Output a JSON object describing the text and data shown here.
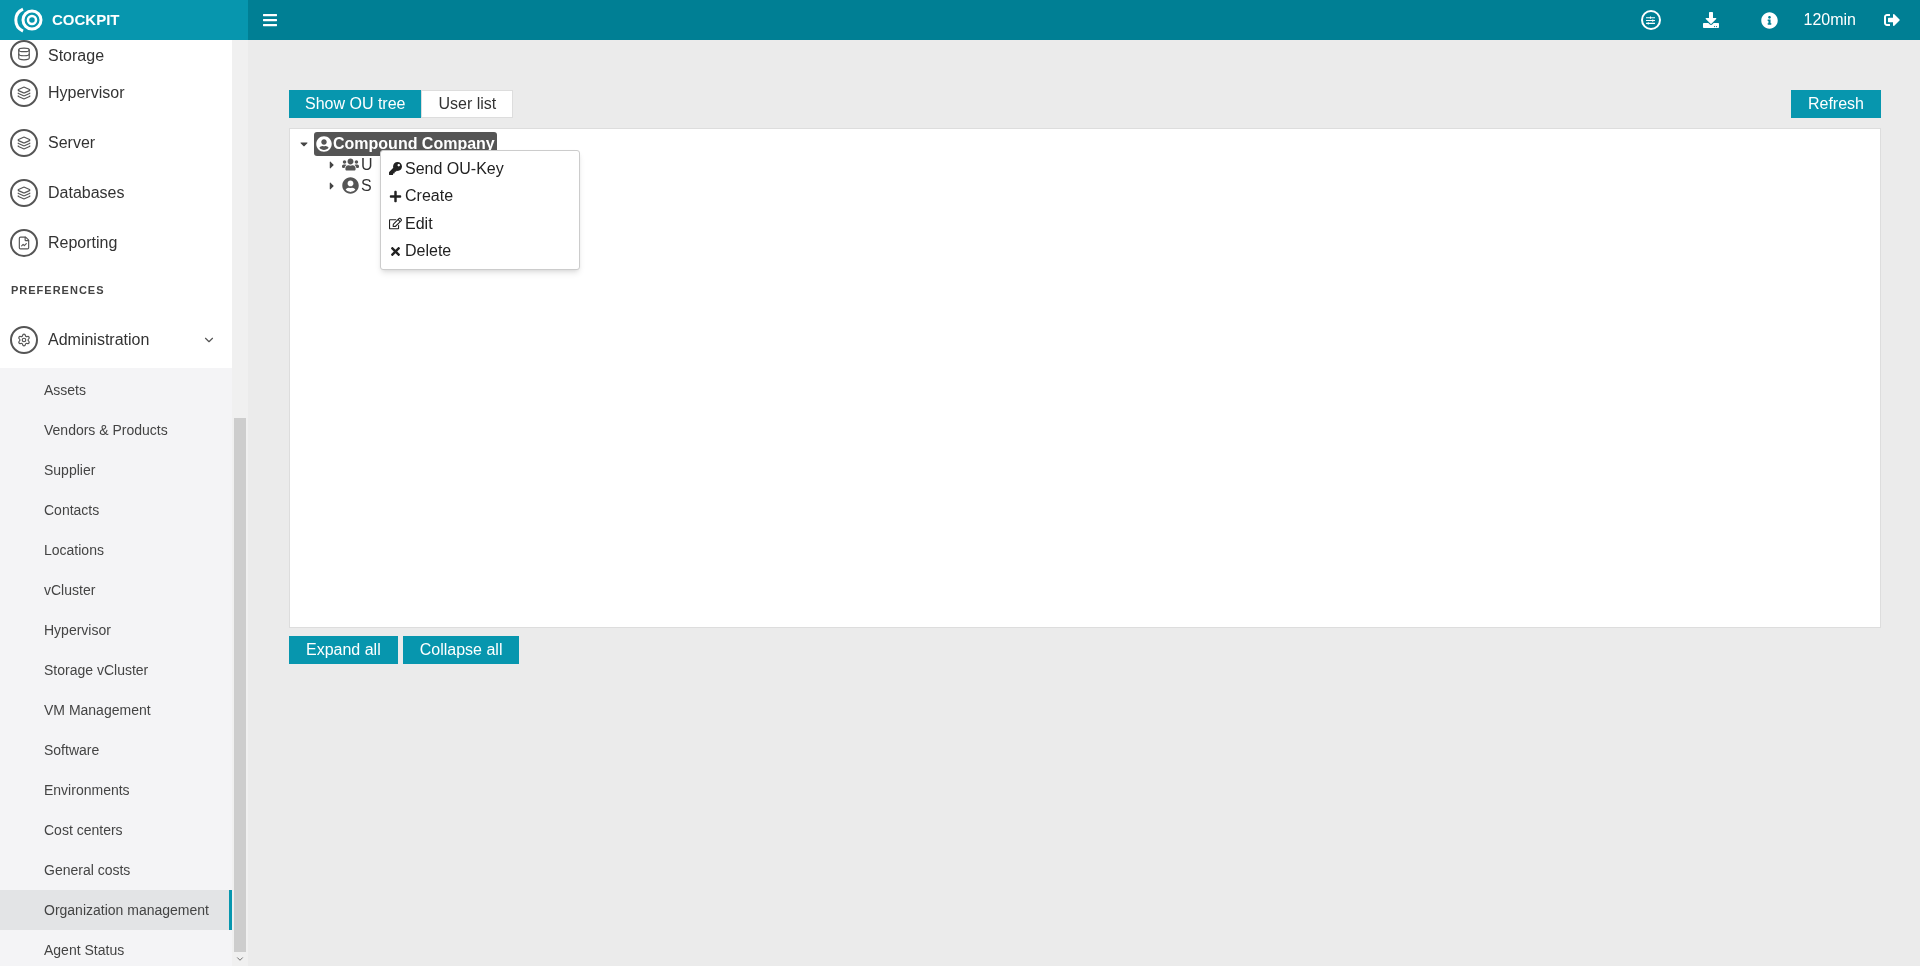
{
  "brand": "COCKPIT",
  "header": {
    "session": "120min"
  },
  "sidebar": {
    "items": [
      {
        "label": "Storage",
        "kind": "storage"
      },
      {
        "label": "Hypervisor",
        "kind": "stack"
      },
      {
        "label": "Server",
        "kind": "stack"
      },
      {
        "label": "Databases",
        "kind": "stack"
      },
      {
        "label": "Reporting",
        "kind": "report"
      }
    ],
    "section": "PREFERENCES",
    "group": {
      "label": "Administration",
      "expanded": true,
      "children": [
        {
          "label": "Assets",
          "selected": false
        },
        {
          "label": "Vendors & Products",
          "selected": false
        },
        {
          "label": "Supplier",
          "selected": false
        },
        {
          "label": "Contacts",
          "selected": false
        },
        {
          "label": "Locations",
          "selected": false
        },
        {
          "label": "vCluster",
          "selected": false
        },
        {
          "label": "Hypervisor",
          "selected": false
        },
        {
          "label": "Storage vCluster",
          "selected": false
        },
        {
          "label": "VM Management",
          "selected": false
        },
        {
          "label": "Software",
          "selected": false
        },
        {
          "label": "Environments",
          "selected": false
        },
        {
          "label": "Cost centers",
          "selected": false
        },
        {
          "label": "General costs",
          "selected": false
        },
        {
          "label": "Organization management",
          "selected": true
        },
        {
          "label": "Agent Status",
          "selected": false
        }
      ]
    }
  },
  "tabs": [
    {
      "label": "Show OU tree",
      "selected": true
    },
    {
      "label": "User list",
      "selected": false
    }
  ],
  "refresh": "Refresh",
  "tree": {
    "label": "Compound Company",
    "expanded": true,
    "selected": true,
    "children": [
      {
        "label": "U",
        "kind": "group",
        "expanded": false
      },
      {
        "label": "S",
        "kind": "person",
        "expanded": false
      }
    ]
  },
  "context_menu": [
    {
      "label": "Send OU-Key",
      "kind": "key"
    },
    {
      "label": "Create",
      "kind": "plus"
    },
    {
      "label": "Edit",
      "kind": "edit"
    },
    {
      "label": "Delete",
      "kind": "delete"
    }
  ],
  "buttons": [
    "Expand all",
    "Collapse all"
  ]
}
